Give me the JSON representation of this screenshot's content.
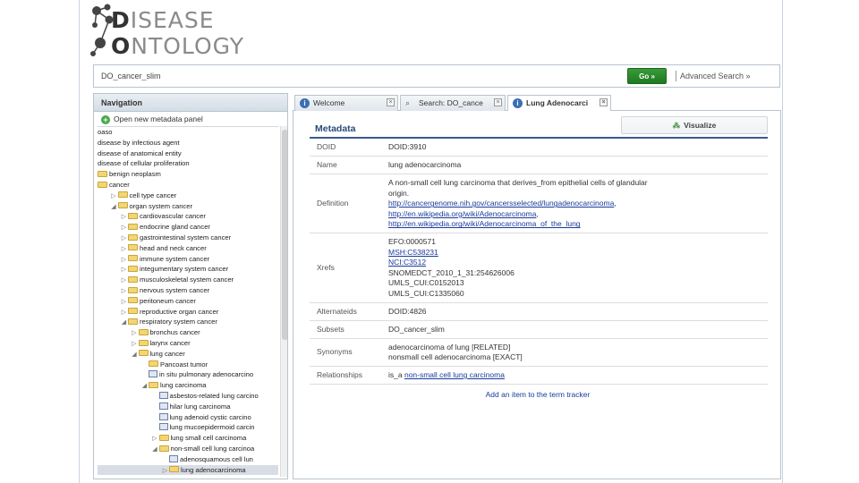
{
  "logo": {
    "line1_cap": "D",
    "line1_rest": "ISEASE",
    "line2_cap": "O",
    "line2_rest": "NTOLOGY"
  },
  "search": {
    "value": "DO_cancer_slim",
    "go_label": "Go »",
    "advanced_label": "Advanced Search »"
  },
  "nav": {
    "title": "Navigation",
    "open_panel_label": "Open new metadata panel",
    "tree": [
      {
        "label": "oaso",
        "depth": 0,
        "kind": "none",
        "arrow": ""
      },
      {
        "label": "disease by infectious agent",
        "depth": 0,
        "kind": "none",
        "arrow": ""
      },
      {
        "label": "disease of anatomical entity",
        "depth": 0,
        "kind": "none",
        "arrow": ""
      },
      {
        "label": "disease of cellular proliferation",
        "depth": 0,
        "kind": "none",
        "arrow": ""
      },
      {
        "label": "benign neoplasm",
        "depth": 0,
        "kind": "folder",
        "arrow": ""
      },
      {
        "label": "cancer",
        "depth": 0,
        "kind": "folder",
        "arrow": ""
      },
      {
        "label": "cell type cancer",
        "depth": 1,
        "kind": "folder",
        "arrow": "▷"
      },
      {
        "label": "organ system cancer",
        "depth": 1,
        "kind": "folder",
        "arrow": "◢"
      },
      {
        "label": "cardiovascular cancer",
        "depth": 2,
        "kind": "folder",
        "arrow": "▷"
      },
      {
        "label": "endocrine gland cancer",
        "depth": 2,
        "kind": "folder",
        "arrow": "▷"
      },
      {
        "label": "gastrointestinal system cancer",
        "depth": 2,
        "kind": "folder",
        "arrow": "▷"
      },
      {
        "label": "head and neck cancer",
        "depth": 2,
        "kind": "folder",
        "arrow": "▷"
      },
      {
        "label": "immune system cancer",
        "depth": 2,
        "kind": "folder",
        "arrow": "▷"
      },
      {
        "label": "integumentary system cancer",
        "depth": 2,
        "kind": "folder",
        "arrow": "▷"
      },
      {
        "label": "musculoskeletal system cancer",
        "depth": 2,
        "kind": "folder",
        "arrow": "▷"
      },
      {
        "label": "nervous system cancer",
        "depth": 2,
        "kind": "folder",
        "arrow": "▷"
      },
      {
        "label": "peritoneum cancer",
        "depth": 2,
        "kind": "folder",
        "arrow": "▷"
      },
      {
        "label": "reproductive organ cancer",
        "depth": 2,
        "kind": "folder",
        "arrow": "▷"
      },
      {
        "label": "respiratory system cancer",
        "depth": 2,
        "kind": "folder",
        "arrow": "◢"
      },
      {
        "label": "bronchus cancer",
        "depth": 3,
        "kind": "folder",
        "arrow": "▷"
      },
      {
        "label": "larynx cancer",
        "depth": 3,
        "kind": "folder",
        "arrow": "▷"
      },
      {
        "label": "lung cancer",
        "depth": 3,
        "kind": "folder",
        "arrow": "◢"
      },
      {
        "label": "Pancoast tumor",
        "depth": 4,
        "kind": "folder",
        "arrow": ""
      },
      {
        "label": "in situ pulmonary adenocarcino",
        "depth": 4,
        "kind": "leaf",
        "arrow": ""
      },
      {
        "label": "lung carcinoma",
        "depth": 4,
        "kind": "folder",
        "arrow": "◢"
      },
      {
        "label": "asbestos-related lung carcino",
        "depth": 5,
        "kind": "leaf",
        "arrow": ""
      },
      {
        "label": "hilar lung carcinoma",
        "depth": 5,
        "kind": "leaf",
        "arrow": ""
      },
      {
        "label": "lung adenoid cystic carcino",
        "depth": 5,
        "kind": "leaf",
        "arrow": ""
      },
      {
        "label": "lung mucoepidermoid carcin",
        "depth": 5,
        "kind": "leaf",
        "arrow": ""
      },
      {
        "label": "lung small cell carcinoma",
        "depth": 5,
        "kind": "folder",
        "arrow": "▷"
      },
      {
        "label": "non-small cell lung carcinoa",
        "depth": 5,
        "kind": "folder",
        "arrow": "◢"
      },
      {
        "label": "adenosquamous cell lun",
        "depth": 6,
        "kind": "leaf",
        "arrow": ""
      },
      {
        "label": "lung adenocarcinoma",
        "depth": 6,
        "kind": "folder",
        "arrow": "▷",
        "selected": true
      }
    ]
  },
  "tabs": [
    {
      "label": "Welcome",
      "icon": "info-icon",
      "closable": true,
      "active": false
    },
    {
      "label": "Search: DO_cance",
      "icon": "search-icon",
      "closable": true,
      "active": false
    },
    {
      "label": "Lung Adenocarci",
      "icon": "info-icon",
      "closable": true,
      "active": true
    }
  ],
  "metadata": {
    "title": "Metadata",
    "visualize_label": "Visualize",
    "rows": [
      {
        "label": "DOID",
        "lines": [
          {
            "text": "DOID:3910",
            "link": false
          }
        ]
      },
      {
        "label": "Name",
        "lines": [
          {
            "text": "lung adenocarcinoma",
            "link": false
          }
        ]
      },
      {
        "label": "Definition",
        "lines": [
          {
            "text": "A non-small cell lung carcinoma that derives_from epithelial cells of glandular",
            "link": false
          },
          {
            "text": "origin.",
            "link": false
          },
          {
            "text": "http://cancergenome.nih.gov/cancersselected/lungadenocarcinoma",
            "link": true,
            "suffix": ","
          },
          {
            "text": "http://en.wikipedia.org/wiki/Adenocarcinoma",
            "link": true,
            "suffix": ","
          },
          {
            "text": "http://en.wikipedia.org/wiki/Adenocarcinoma_of_the_lung",
            "link": true,
            "suffix": ""
          }
        ]
      },
      {
        "label": "Xrefs",
        "lines": [
          {
            "text": "EFO:0000571",
            "link": false
          },
          {
            "text": "MSH:C538231",
            "link": true
          },
          {
            "text": "NCI:C3512",
            "link": true
          },
          {
            "text": "SNOMEDCT_2010_1_31:254626006",
            "link": false
          },
          {
            "text": "UMLS_CUI:C0152013",
            "link": false
          },
          {
            "text": "UMLS_CUI:C1335060",
            "link": false
          }
        ]
      },
      {
        "label": "Alternateids",
        "lines": [
          {
            "text": "DOID:4826",
            "link": false
          }
        ]
      },
      {
        "label": "Subsets",
        "lines": [
          {
            "text": "DO_cancer_slim",
            "link": false
          }
        ]
      },
      {
        "label": "Synonyms",
        "lines": [
          {
            "text": "adenocarcinoma of lung [RELATED]",
            "link": false
          },
          {
            "text": "nonsmall cell adenocarcinoma [EXACT]",
            "link": false
          }
        ]
      },
      {
        "label": "Relationships",
        "lines": [
          {
            "text": "is_a",
            "link": false,
            "link_text": "non-small cell lung carcinoma"
          }
        ]
      }
    ],
    "add_tracker_label": "Add an item to the term tracker"
  }
}
